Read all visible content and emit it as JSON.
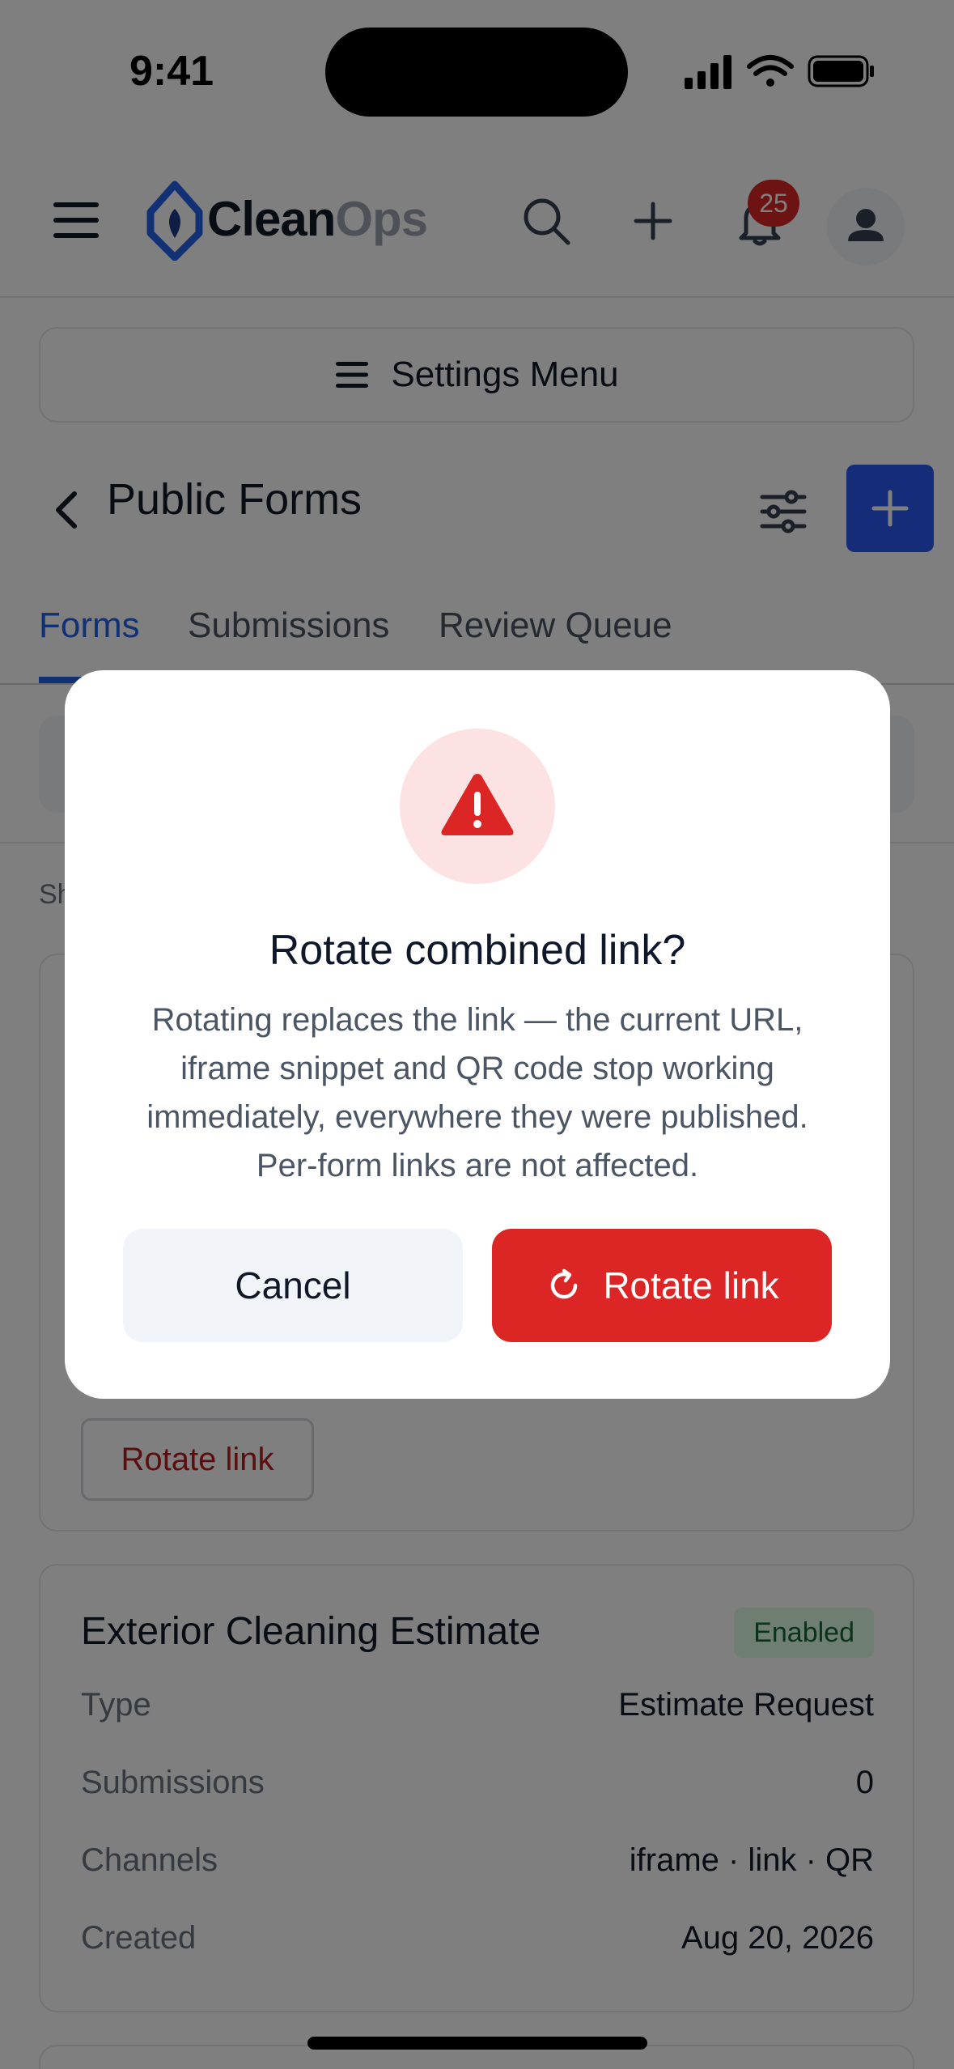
{
  "status_bar": {
    "time": "9:41"
  },
  "header": {
    "logo_clean": "Clean",
    "logo_ops": "Ops",
    "notification_count": "25"
  },
  "settings_menu": {
    "label": "Settings Menu"
  },
  "page": {
    "title": "Public Forms"
  },
  "tabs": [
    {
      "label": "Forms",
      "active": true
    },
    {
      "label": "Submissions",
      "active": false
    },
    {
      "label": "Review Queue",
      "active": false
    }
  ],
  "results": {
    "showing_fragment": "Sh"
  },
  "combined_card": {
    "rotate_label": "Rotate link"
  },
  "form_card": {
    "title": "Exterior Cleaning Estimate",
    "status": "Enabled",
    "rows": [
      {
        "label": "Type",
        "value": "Estimate Request"
      },
      {
        "label": "Submissions",
        "value": "0"
      },
      {
        "label": "Channels",
        "value": "iframe · link · QR"
      },
      {
        "label": "Created",
        "value": "Aug 20, 2026"
      }
    ]
  },
  "modal": {
    "title": "Rotate combined link?",
    "body": "Rotating replaces the link — the current URL, iframe snippet and QR code stop working immediately, everywhere they were published. Per-form links are not affected.",
    "cancel_label": "Cancel",
    "confirm_label": "Rotate link"
  },
  "colors": {
    "primary": "#2563eb",
    "danger": "#dc2626",
    "success_bg": "#dcfce7",
    "success_text": "#166534"
  }
}
